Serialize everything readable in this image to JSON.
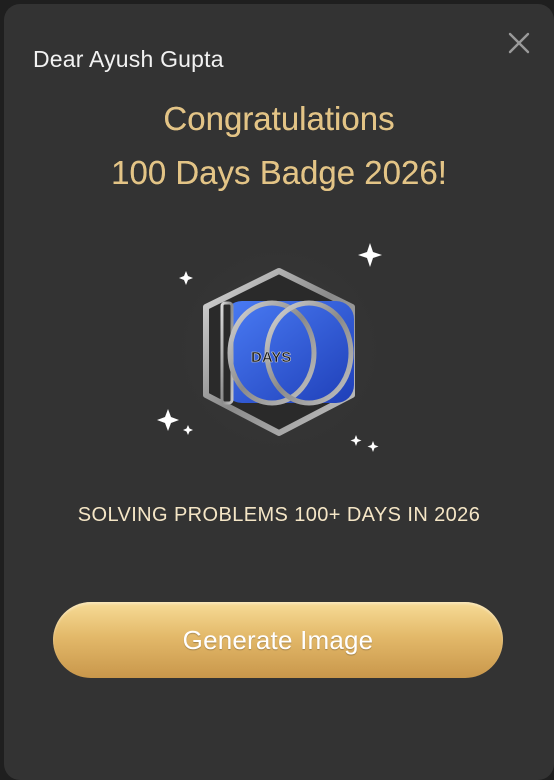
{
  "greeting": "Dear Ayush Gupta",
  "title": {
    "line1": "Congratulations",
    "line2": "100 Days Badge 2026!"
  },
  "badge": {
    "label": "DAYS",
    "icon": "100-days-badge-icon"
  },
  "subtitle": "SOLVING PROBLEMS 100+ DAYS IN 2026",
  "buttons": {
    "generate_label": "Generate Image",
    "close_icon": "close-icon"
  },
  "colors": {
    "background": "#333333",
    "gold_text": "#e3c486",
    "button_gold": "#e3b96a",
    "badge_blue": "#2f5fe0"
  }
}
